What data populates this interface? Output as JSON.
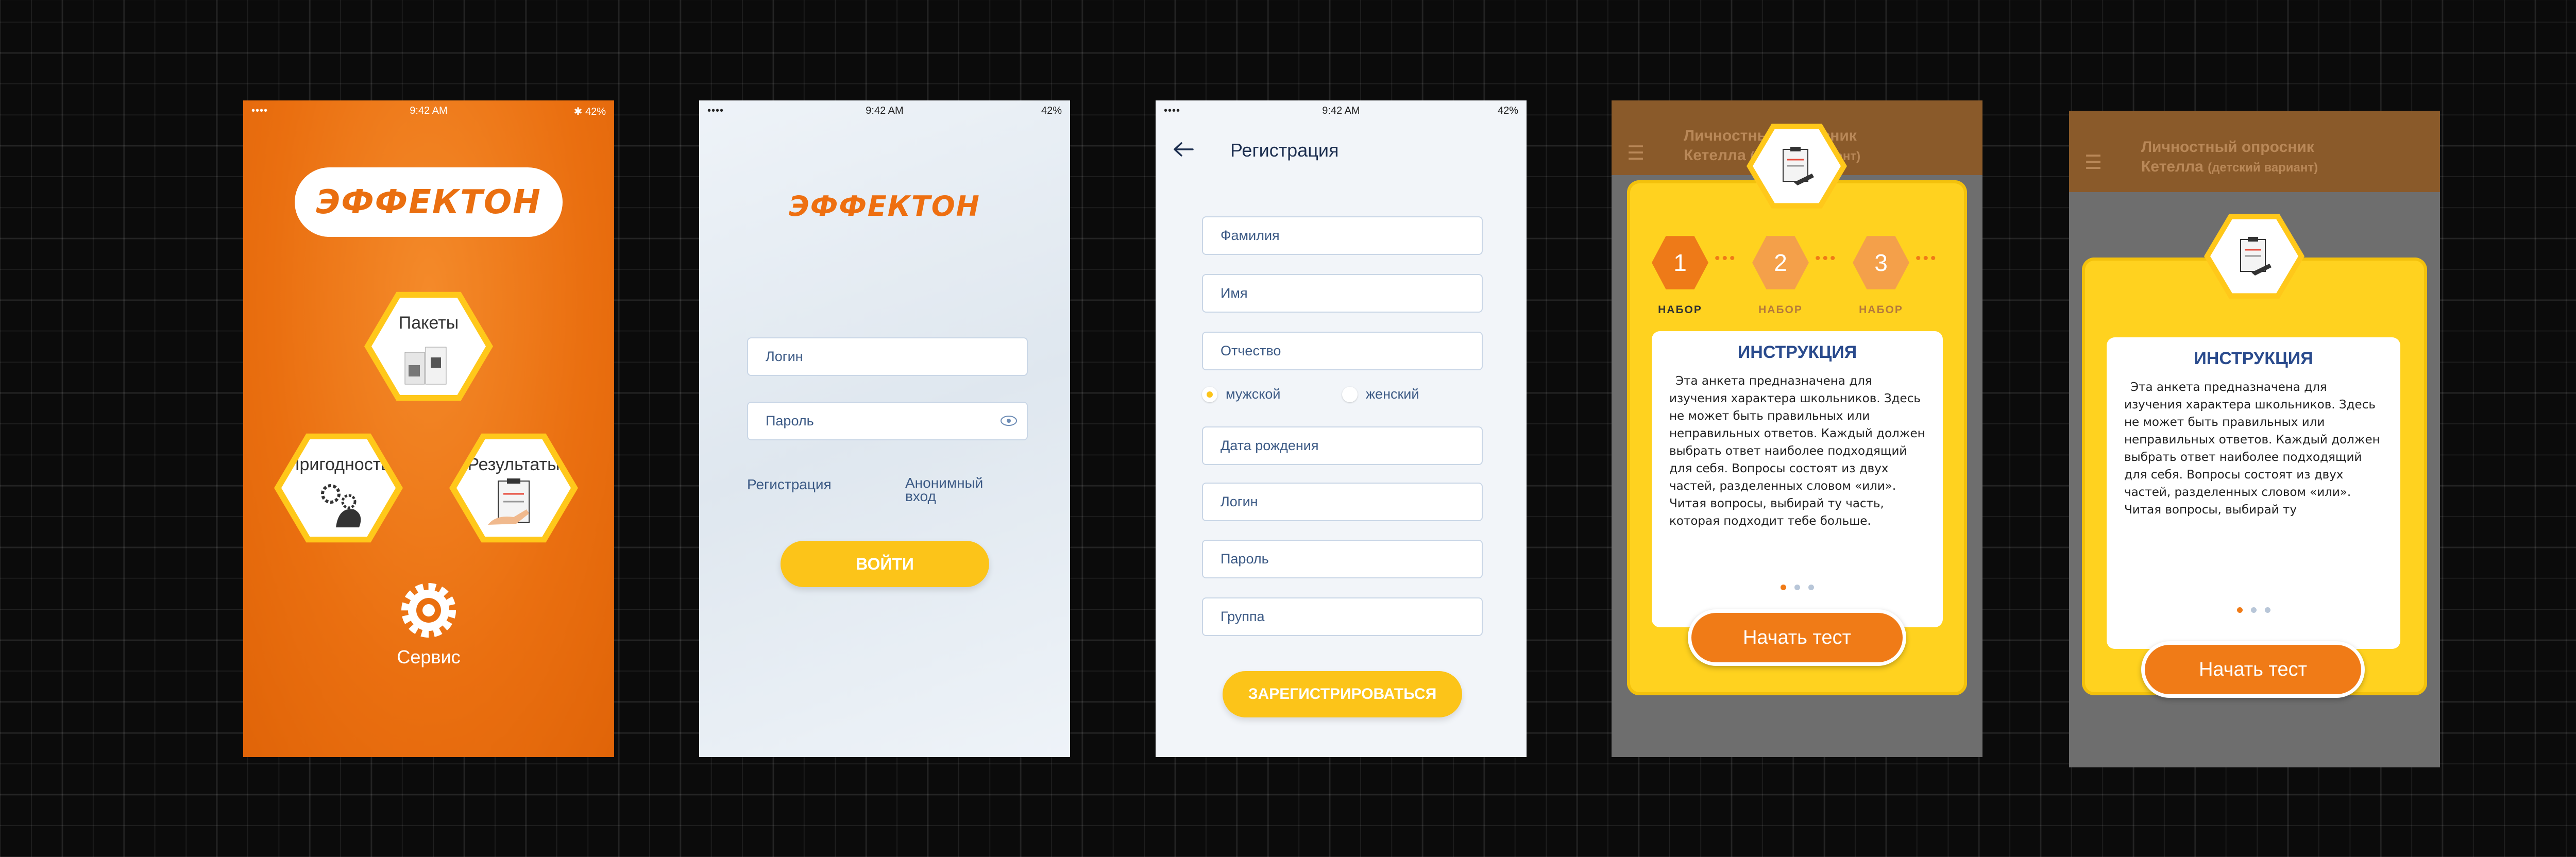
{
  "status": {
    "signal": "•••• ",
    "time": "9:42 AM",
    "battery_p1": "✱ 42%",
    "battery": "42%"
  },
  "brand": {
    "logo_text": "ЭФФЕКТОН"
  },
  "home": {
    "menu": [
      {
        "label": "Пакеты"
      },
      {
        "label": "Пригодность"
      },
      {
        "label": "Результаты"
      }
    ],
    "service_label": "Сервис"
  },
  "login": {
    "login_placeholder": "Логин",
    "password_placeholder": "Пароль",
    "register_link": "Регистрация",
    "anonymous_link": "Анонимный вход",
    "submit": "ВОЙТИ"
  },
  "registration": {
    "title": "Регистрация",
    "fields": [
      "Фамилия",
      "Имя",
      "Отчество"
    ],
    "gender": {
      "male": "мужской",
      "female": "женский"
    },
    "fields2": [
      "Дата рождения",
      "Логин",
      "Пароль",
      "Группа"
    ],
    "submit": "ЗАРЕГИСТРИРОВАТЬСЯ"
  },
  "survey": {
    "title_line1": "Личностный опросник",
    "title_line2": "Кетелла",
    "subtitle": "(детский вариант)",
    "steps": [
      {
        "num": "1",
        "label": "НАБОР"
      },
      {
        "num": "2",
        "label": "НАБОР"
      },
      {
        "num": "3",
        "label": "НАБОР"
      }
    ],
    "card_title": "ИНСТРУКЦИЯ",
    "instruction_full": "Эта анкета предназначена для изучения характера школьников. Здесь не может быть правильных или неправильных ответов. Каждый должен выбрать ответ наиболее подходящий для себя. Вопросы состоят из двух частей, разделенных словом «или». Читая вопросы, выбирай ту часть, которая подходит тебе больше.",
    "instruction_short": "Эта анкета предназначена для изучения характера школьников. Здесь не может быть правильных или неправильных ответов. Каждый должен выбрать ответ наиболее подходящий для себя. Вопросы состоят из двух частей, разделенных словом «или». Читая вопросы, выбирай ту",
    "start_button": "Начать тест"
  },
  "colors": {
    "brand_orange": "#ea6f10",
    "accent_yellow": "#fcc419",
    "link_blue": "#3c5a85"
  }
}
